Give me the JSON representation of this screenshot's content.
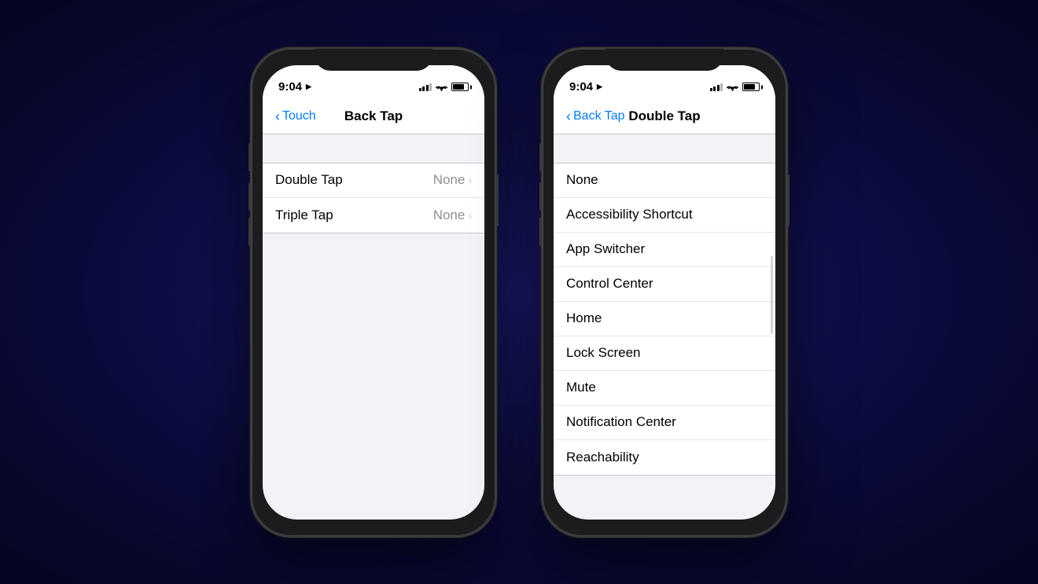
{
  "background": "#0a0a3a",
  "phone_left": {
    "status": {
      "time": "9:04",
      "location_arrow": "▲",
      "signal": [
        true,
        true,
        true,
        false
      ],
      "wifi": "wifi",
      "battery": 80
    },
    "nav": {
      "back_label": "Touch",
      "title": "Back Tap"
    },
    "list_items": [
      {
        "label": "Double Tap",
        "value": "None"
      },
      {
        "label": "Triple Tap",
        "value": "None"
      }
    ]
  },
  "phone_right": {
    "status": {
      "time": "9:04",
      "location_arrow": "▲",
      "signal": [
        true,
        true,
        true,
        false
      ],
      "wifi": "wifi",
      "battery": 80
    },
    "nav": {
      "back_label": "Back Tap",
      "title": "Double Tap"
    },
    "list_items": [
      "None",
      "Accessibility Shortcut",
      "App Switcher",
      "Control Center",
      "Home",
      "Lock Screen",
      "Mute",
      "Notification Center",
      "Reachability"
    ]
  }
}
